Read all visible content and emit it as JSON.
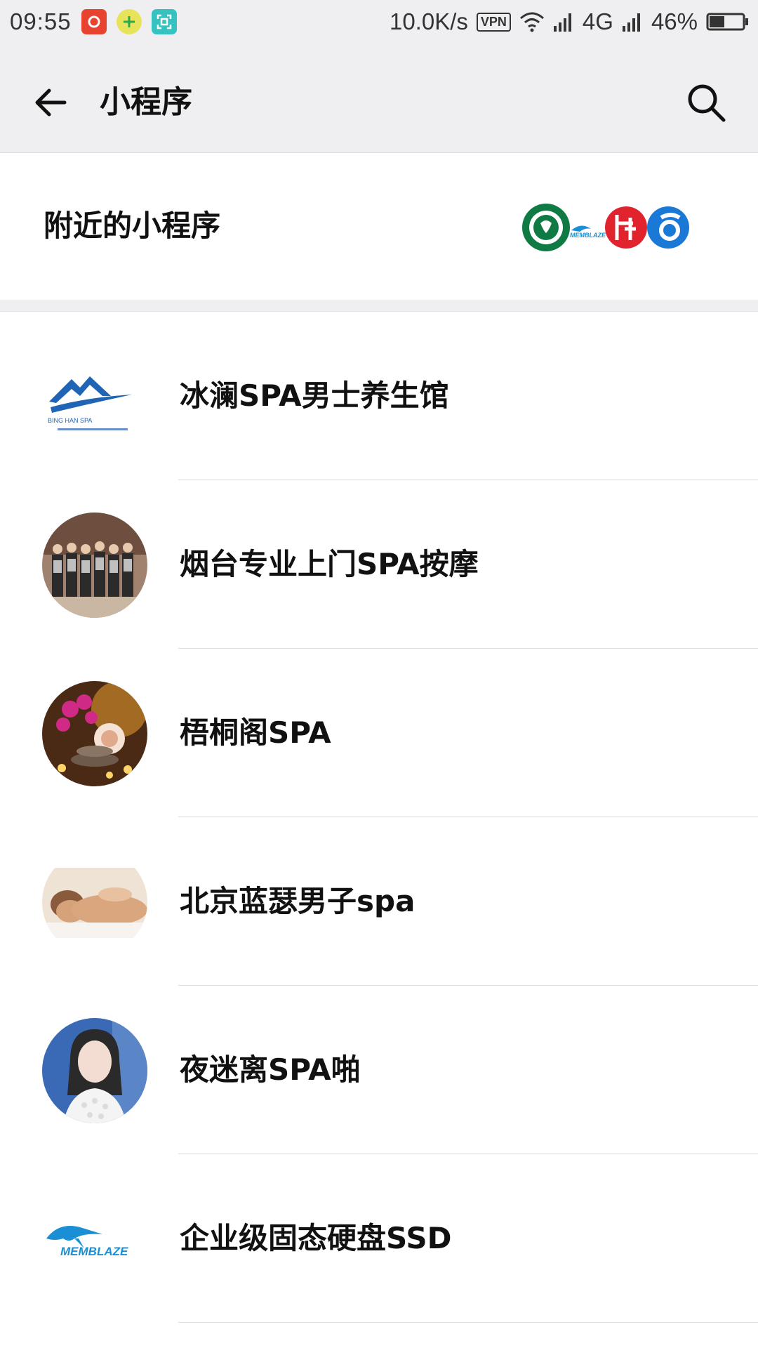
{
  "status_bar": {
    "time": "09:55",
    "network_speed": "10.0K/s",
    "vpn_label": "VPN",
    "network_type": "4G",
    "battery_percent": "46%",
    "battery_level": 0.46
  },
  "header": {
    "title": "小程序",
    "back_icon": "arrow-left-icon",
    "search_icon": "search-icon"
  },
  "nearby": {
    "label": "附近的小程序",
    "logos": [
      "starbucks-logo",
      "memblaze-logo",
      "red-circle-logo",
      "blue-circle-logo"
    ],
    "memblaze_logo_text": "MEMBLAZE"
  },
  "mini_programs": [
    {
      "name": "冰澜SPA男士养生馆",
      "icon": "bing-lan-spa-logo",
      "logo_text": "BING HAN SPA"
    },
    {
      "name": "烟台专业上门SPA按摩",
      "icon": "team-photo-avatar"
    },
    {
      "name": "梧桐阁SPA",
      "icon": "orchid-candles-avatar"
    },
    {
      "name": "北京蓝瑟男子spa",
      "icon": "massage-photo-avatar"
    },
    {
      "name": "夜迷离SPA啪",
      "icon": "woman-portrait-avatar"
    },
    {
      "name": "企业级固态硬盘SSD",
      "icon": "memblaze-logo",
      "logo_text": "MEMBLAZE"
    }
  ],
  "colors": {
    "header_bg": "#efeff1",
    "divider": "#dcdcdc",
    "starbucks_green": "#0f7a43",
    "memblaze_blue": "#1b8fd6",
    "bing_lan_blue": "#1f64b5"
  }
}
